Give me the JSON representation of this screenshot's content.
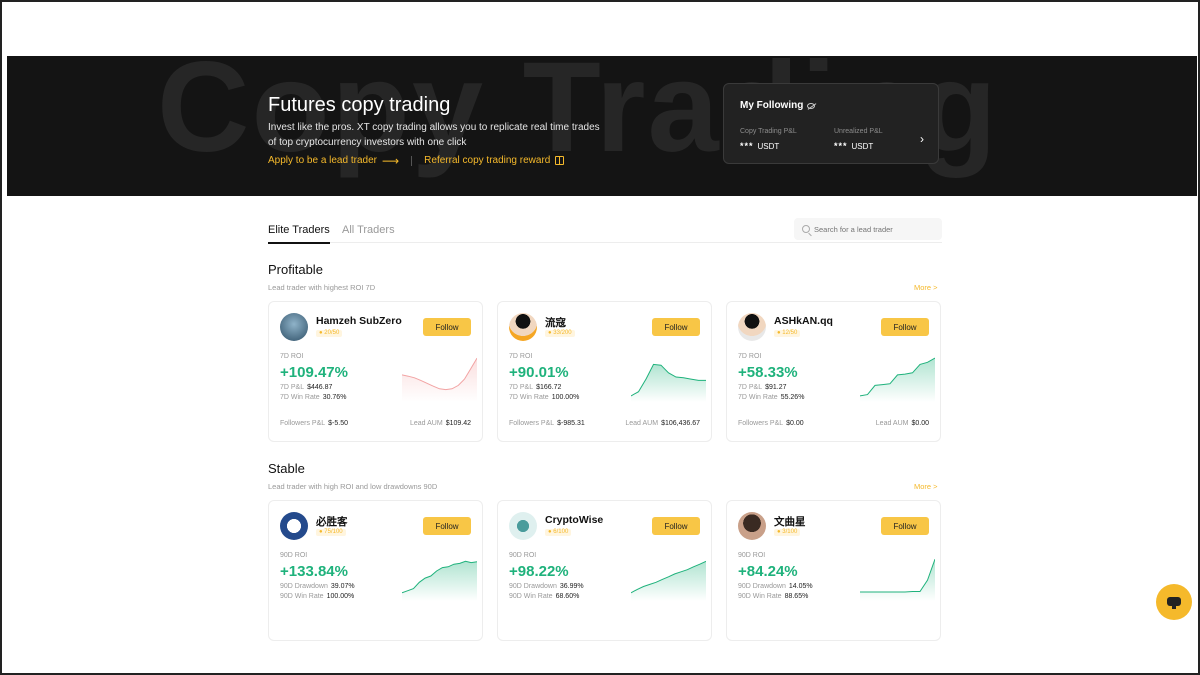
{
  "hero": {
    "bg_text": "Copy Trading",
    "title": "Futures copy trading",
    "description": "Invest like the pros. XT copy trading allows you to replicate real time trades of top cryptocurrency investors with one click",
    "apply_link": "Apply to be a lead trader",
    "referral_link": "Referral copy trading reward"
  },
  "following": {
    "title": "My Following",
    "pnl_label": "Copy Trading P&L",
    "pnl_value": "***",
    "pnl_unit": "USDT",
    "unrealized_label": "Unrealized P&L",
    "unrealized_value": "***",
    "unrealized_unit": "USDT"
  },
  "tabs": {
    "elite": "Elite Traders",
    "all": "All Traders"
  },
  "search": {
    "placeholder": "Search for a lead trader"
  },
  "profitable": {
    "title": "Profitable",
    "subtitle": "Lead trader with highest ROI 7D",
    "more": "More >",
    "cards": [
      {
        "name": "Hamzeh SubZero",
        "badge": "20/50",
        "follow": "Follow",
        "roi_label": "7D ROI",
        "roi": "+109.47%",
        "stat1_label": "7D P&L",
        "stat1_value": "$446.87",
        "stat2_label": "7D Win Rate",
        "stat2_value": "30.76%",
        "footer_left_label": "Followers P&L",
        "footer_left_value": "$-5.50",
        "footer_right_label": "Lead AUM",
        "footer_right_value": "$109.42",
        "line_color": "#f2a3a3",
        "spark": [
          0.55,
          0.52,
          0.48,
          0.42,
          0.35,
          0.28,
          0.22,
          0.2,
          0.22,
          0.3,
          0.45,
          0.7,
          0.95
        ]
      },
      {
        "name": "流寇",
        "badge": "33/200",
        "follow": "Follow",
        "roi_label": "7D ROI",
        "roi": "+90.01%",
        "stat1_label": "7D P&L",
        "stat1_value": "$166.72",
        "stat2_label": "7D Win Rate",
        "stat2_value": "100.00%",
        "footer_left_label": "Followers P&L",
        "footer_left_value": "$-985.31",
        "footer_right_label": "Lead AUM",
        "footer_right_value": "$106,436.67",
        "line_color": "#1fb27c",
        "spark": [
          0.05,
          0.15,
          0.45,
          0.8,
          0.78,
          0.6,
          0.5,
          0.48,
          0.45,
          0.42,
          0.42
        ]
      },
      {
        "name": "ASHkAN.qq",
        "badge": "12/50",
        "follow": "Follow",
        "roi_label": "7D ROI",
        "roi": "+58.33%",
        "stat1_label": "7D P&L",
        "stat1_value": "$91.27",
        "stat2_label": "7D Win Rate",
        "stat2_value": "55.26%",
        "footer_left_label": "Followers P&L",
        "footer_left_value": "$0.00",
        "footer_right_label": "Lead AUM",
        "footer_right_value": "$0.00",
        "line_color": "#1fb27c",
        "spark": [
          0.05,
          0.08,
          0.3,
          0.32,
          0.34,
          0.55,
          0.57,
          0.6,
          0.8,
          0.85,
          0.95
        ]
      }
    ]
  },
  "stable": {
    "title": "Stable",
    "subtitle": "Lead trader with high ROI and low drawdowns 90D",
    "more": "More >",
    "cards": [
      {
        "name": "必胜客",
        "badge": "75/100",
        "follow": "Follow",
        "roi_label": "90D ROI",
        "roi": "+133.84%",
        "stat1_label": "90D Drawdown",
        "stat1_value": "39.07%",
        "stat2_label": "90D Win Rate",
        "stat2_value": "100.00%",
        "line_color": "#1fb27c",
        "spark": [
          0.1,
          0.15,
          0.2,
          0.35,
          0.45,
          0.5,
          0.62,
          0.7,
          0.72,
          0.78,
          0.8,
          0.85,
          0.82,
          0.84
        ]
      },
      {
        "name": "CryptoWise",
        "badge": "6/100",
        "follow": "Follow",
        "roi_label": "90D ROI",
        "roi": "+98.22%",
        "stat1_label": "90D Drawdown",
        "stat1_value": "36.99%",
        "stat2_label": "90D Win Rate",
        "stat2_value": "68.60%",
        "line_color": "#1fb27c",
        "spark": [
          0.1,
          0.18,
          0.25,
          0.3,
          0.35,
          0.42,
          0.48,
          0.55,
          0.6,
          0.65,
          0.72,
          0.78,
          0.85
        ]
      },
      {
        "name": "文曲星",
        "badge": "3/100",
        "follow": "Follow",
        "roi_label": "90D ROI",
        "roi": "+84.24%",
        "stat1_label": "90D Drawdown",
        "stat1_value": "14.05%",
        "stat2_label": "90D Win Rate",
        "stat2_value": "88.65%",
        "line_color": "#1fb27c",
        "spark": [
          0.12,
          0.12,
          0.12,
          0.12,
          0.12,
          0.12,
          0.12,
          0.13,
          0.13,
          0.4,
          0.9
        ]
      }
    ]
  },
  "colors": {
    "accent": "#f5b92b",
    "positive": "#1fb27c",
    "hero_bg": "#141414"
  }
}
